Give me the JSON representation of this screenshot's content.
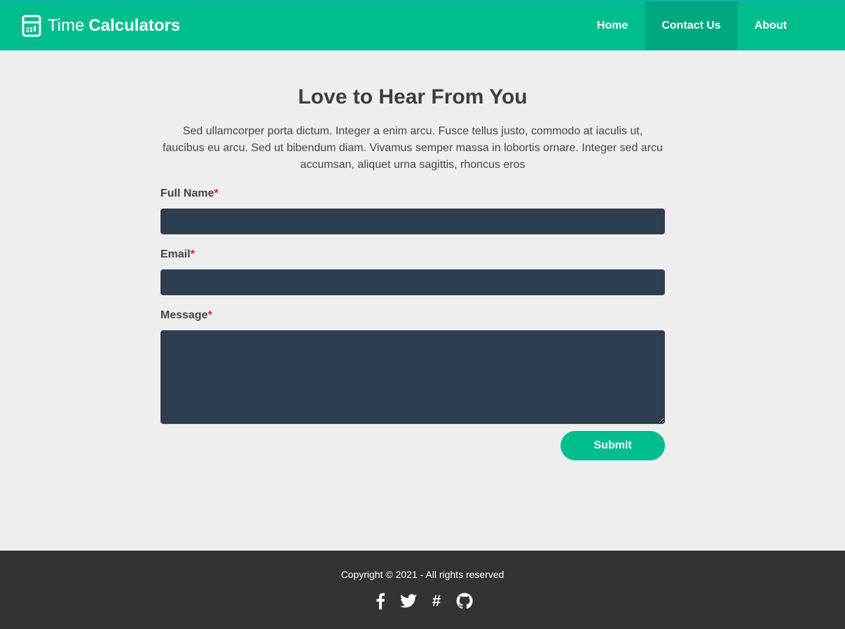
{
  "header": {
    "brand_light": "Time",
    "brand_bold": "Calculators",
    "nav": [
      "Home",
      "Contact Us",
      "About"
    ]
  },
  "main": {
    "title": "Love to Hear From You",
    "intro": "Sed ullamcorper porta dictum. Integer a enim arcu. Fusce tellus justo, commodo at iaculis ut, faucibus eu arcu. Sed ut bibendum diam. Vivamus semper massa in lobortis ornare. Integer sed arcu accumsan, aliquet urna sagittis, rhoncus eros",
    "fields": [
      {
        "label": "Full Name",
        "value": ""
      },
      {
        "label": "Email",
        "value": ""
      },
      {
        "label": "Message",
        "value": ""
      }
    ],
    "required_mark": "*",
    "submit": "Submit"
  },
  "footer": {
    "copyright": "Copyright © 2021 - All rights reserved",
    "social": [
      "facebook",
      "twitter",
      "slack",
      "github"
    ]
  },
  "colors": {
    "accent": "#00bd8e",
    "input_bg": "#2c3e50",
    "footer_bg": "#333333"
  }
}
